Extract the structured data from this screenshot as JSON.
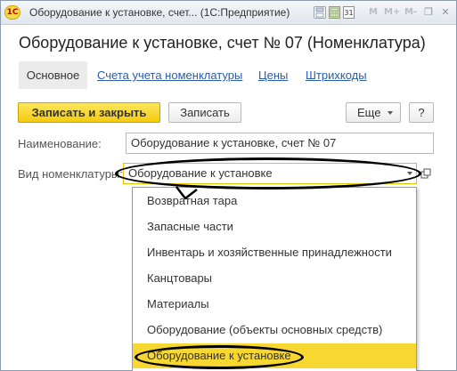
{
  "window": {
    "app_logo": "1С",
    "title": "Оборудование к установке, счет... (1С:Предприятие)",
    "toolbar_icons": [
      "save-icon",
      "calendar-icon",
      "calendar-31-icon",
      "m-icon",
      "m-plus-icon",
      "m-minus-icon",
      "restore-window-icon",
      "close-icon"
    ],
    "toolbar_glyphs": {
      "calendar_31": "31",
      "m": "M",
      "m_plus": "M+",
      "m_minus": "M-",
      "restore": "❐",
      "close": "✕"
    }
  },
  "page_title": "Оборудование к установке, счет № 07 (Номенклатура)",
  "tabs": [
    {
      "label": "Основное",
      "active": true
    },
    {
      "label": "Счета учета номенклатуры",
      "active": false
    },
    {
      "label": "Цены",
      "active": false
    },
    {
      "label": "Штрихкоды",
      "active": false
    }
  ],
  "command_bar": {
    "save_close_label": "Записать и закрыть",
    "save_label": "Записать",
    "more_label": "Еще",
    "help_label": "?"
  },
  "form": {
    "name_label": "Наименование:",
    "name_value": "Оборудование к установке, счет № 07",
    "type_label": "Вид номенклатуры:",
    "type_value": "Оборудование к установке"
  },
  "dropdown": {
    "items": [
      {
        "label": "Возвратная тара",
        "selected": false
      },
      {
        "label": "Запасные части",
        "selected": false
      },
      {
        "label": "Инвентарь и хозяйственные принадлежности",
        "selected": false
      },
      {
        "label": "Канцтовары",
        "selected": false
      },
      {
        "label": "Материалы",
        "selected": false
      },
      {
        "label": "Оборудование (объекты основных средств)",
        "selected": false
      },
      {
        "label": "Оборудование к установке",
        "selected": true
      }
    ]
  },
  "colors": {
    "accent_yellow": "#f4cb11",
    "selected_item": "#f7d731",
    "link": "#2b5da8",
    "annotation": "#000000"
  }
}
